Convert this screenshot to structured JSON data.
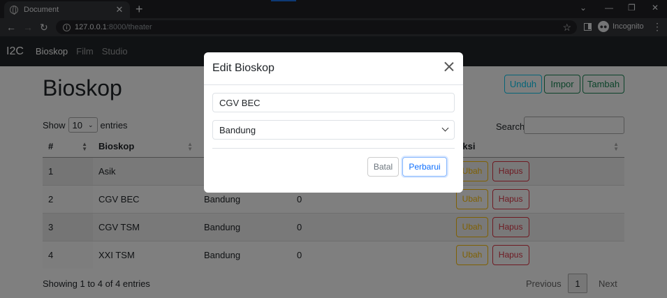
{
  "browser": {
    "tab_title": "Document",
    "url_host": "127.0.0.1",
    "url_path": ":8000/theater",
    "profile_label": "Incognito"
  },
  "navbar": {
    "brand": "I2C",
    "links": [
      "Bioskop",
      "Film",
      "Studio"
    ]
  },
  "page": {
    "title": "Bioskop",
    "buttons": {
      "download": "Unduh",
      "import": "Impor",
      "add": "Tambah"
    }
  },
  "table_controls": {
    "show_label": "Show",
    "page_length": "10",
    "entries_label": "entries",
    "search_label": "Search:"
  },
  "table": {
    "columns": [
      "#",
      "Bioskop",
      "",
      "",
      "Aksi"
    ],
    "rows": [
      {
        "no": "1",
        "name": "Asik",
        "city": "",
        "count": ""
      },
      {
        "no": "2",
        "name": "CGV BEC",
        "city": "Bandung",
        "count": "0"
      },
      {
        "no": "3",
        "name": "CGV TSM",
        "city": "Bandung",
        "count": "0"
      },
      {
        "no": "4",
        "name": "XXI TSM",
        "city": "Bandung",
        "count": "0"
      }
    ],
    "action_edit": "Ubah",
    "action_delete": "Hapus"
  },
  "footer": {
    "info": "Showing 1 to 4 of 4 entries",
    "previous": "Previous",
    "current_page": "1",
    "next": "Next"
  },
  "modal": {
    "title": "Edit Bioskop",
    "name_value": "CGV BEC",
    "city_value": "Bandung",
    "cancel_label": "Batal",
    "update_label": "Perbarui"
  }
}
